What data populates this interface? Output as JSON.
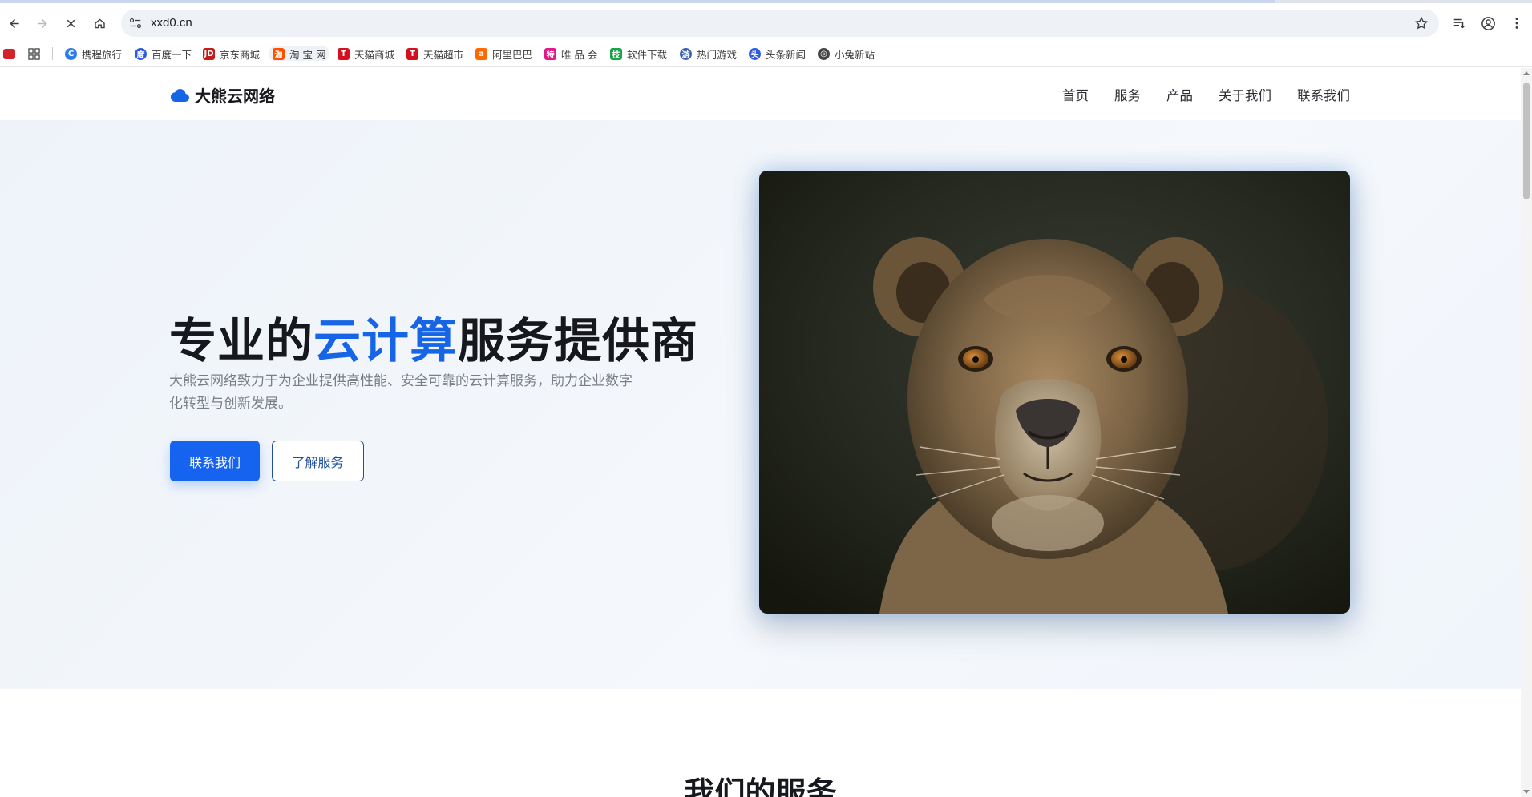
{
  "browser": {
    "url": "xxd0.cn",
    "bookmarks": [
      {
        "label": "携程旅行",
        "icon": "ctrip-icon",
        "color": "#2b7de9"
      },
      {
        "label": "百度一下",
        "icon": "baidu-icon",
        "color": "#2d5be3"
      },
      {
        "label": "京东商城",
        "icon": "jd-icon",
        "color": "#c41a1a"
      },
      {
        "label": "淘 宝 网",
        "icon": "taobao-icon",
        "color": "#ff5000"
      },
      {
        "label": "天猫商城",
        "icon": "tmall-icon",
        "color": "#d40f1e"
      },
      {
        "label": "天猫超市",
        "icon": "tmall-market-icon",
        "color": "#d40f1e"
      },
      {
        "label": "阿里巴巴",
        "icon": "alibaba-icon",
        "color": "#ff6a00"
      },
      {
        "label": "唯 品 会",
        "icon": "vip-icon",
        "color": "#e0188a"
      },
      {
        "label": "软件下载",
        "icon": "software-icon",
        "color": "#1aa34a"
      },
      {
        "label": "热门游戏",
        "icon": "game-icon",
        "color": "#3a5fb0"
      },
      {
        "label": "头条新闻",
        "icon": "news-icon",
        "color": "#2d5be3"
      },
      {
        "label": "小兔新站",
        "icon": "globe-icon",
        "color": "#444444"
      }
    ]
  },
  "site": {
    "brand": "大熊云网络",
    "nav": [
      "首页",
      "服务",
      "产品",
      "关于我们",
      "联系我们"
    ],
    "hero": {
      "title_before": "专业的",
      "title_highlight": "云计算",
      "title_after": "服务提供商",
      "description": "大熊云网络致力于为企业提供高性能、安全可靠的云计算服务，助力企业数字化转型与创新发展。",
      "primary_button": "联系我们",
      "secondary_button": "了解服务"
    },
    "services_heading": "我们的服务"
  },
  "colors": {
    "accent": "#1565e6",
    "primary_button": "#1663f0",
    "outline_button": "#1f4f9e"
  }
}
